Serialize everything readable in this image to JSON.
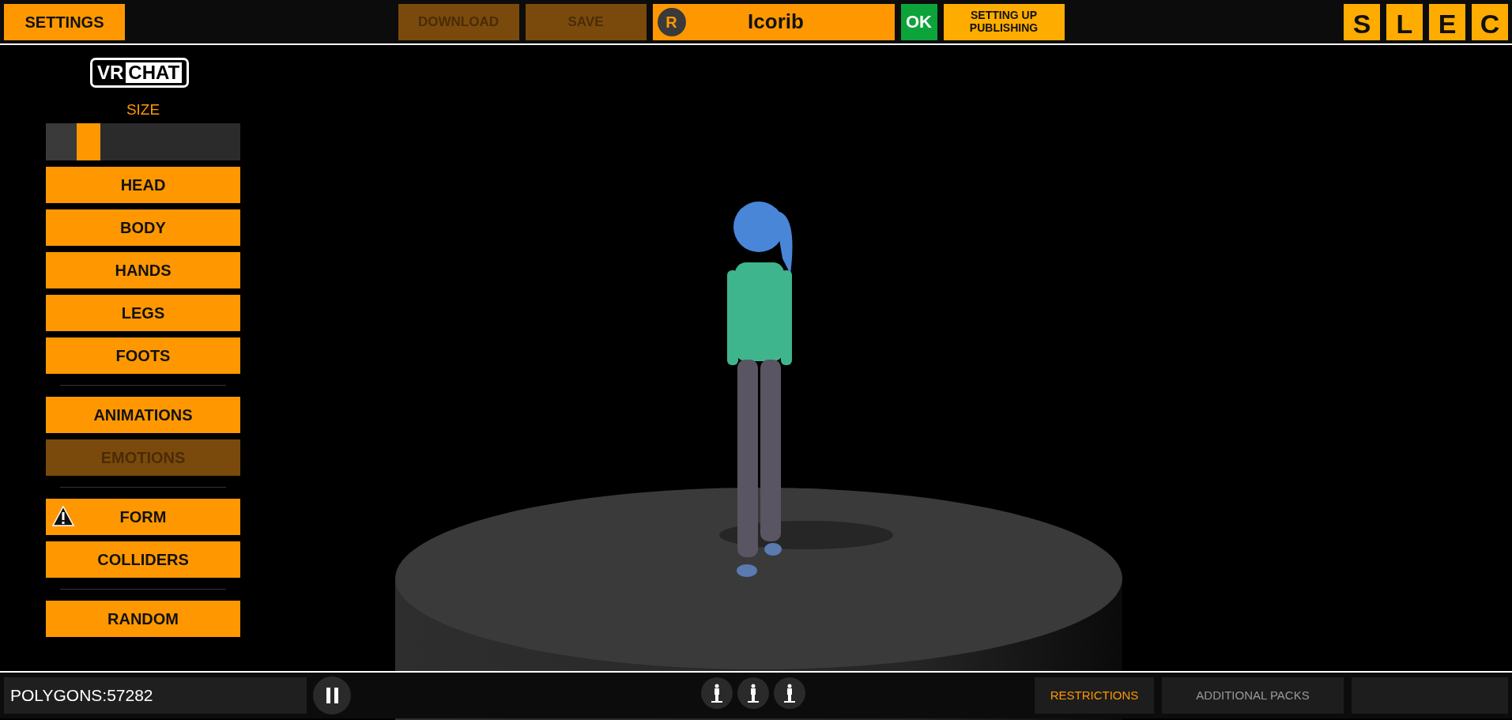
{
  "top_bar": {
    "settings": "SETTINGS",
    "actions": [
      {
        "label": "DOWNLOAD",
        "disabled": true
      },
      {
        "label": "SAVE",
        "disabled": true
      }
    ],
    "avatar_name": {
      "initial": "R",
      "name": "Icorib"
    },
    "ok": "OK",
    "status": "SETTING UP PUBLISHING",
    "letter_buttons": [
      "S",
      "L",
      "E",
      "C"
    ]
  },
  "sidebar": {
    "logo": {
      "left": "VR",
      "right": "CHAT"
    },
    "size": {
      "label": "SIZE",
      "level": 0.28
    },
    "groups": [
      [
        {
          "label": "HEAD",
          "disabled": false,
          "warning": false
        },
        {
          "label": "BODY",
          "disabled": false,
          "warning": false
        },
        {
          "label": "HANDS",
          "disabled": false,
          "warning": false
        },
        {
          "label": "LEGS",
          "disabled": false,
          "warning": false
        },
        {
          "label": "FOOTS",
          "disabled": false,
          "warning": false
        }
      ],
      [
        {
          "label": "ANIMATIONS",
          "disabled": false,
          "warning": false
        },
        {
          "label": "EMOTIONS",
          "disabled": true,
          "warning": false
        }
      ],
      [
        {
          "label": "FORM",
          "disabled": false,
          "warning": true
        },
        {
          "label": "COLLIDERS",
          "disabled": false,
          "warning": false
        }
      ],
      [
        {
          "label": "RANDOM",
          "disabled": false,
          "warning": false
        }
      ]
    ]
  },
  "bottom_bar": {
    "polygons": "POLYGONS:57282",
    "paused": false,
    "tabs": [
      {
        "label": "RESTRICTIONS",
        "selected": true
      },
      {
        "label": "ADDITIONAL PACKS",
        "selected": false
      }
    ]
  }
}
